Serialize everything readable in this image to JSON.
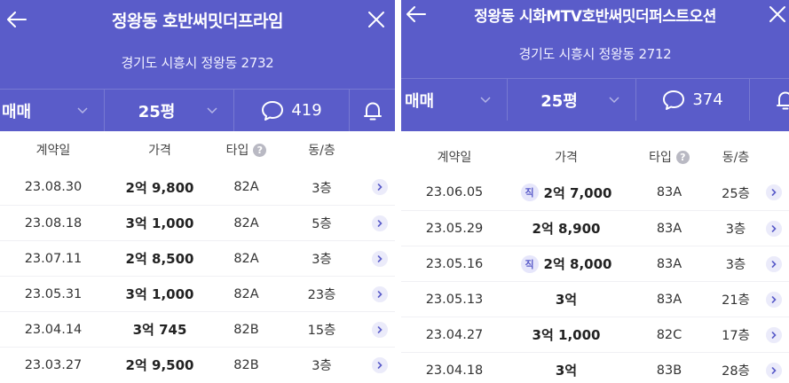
{
  "colors": {
    "header": "#5a5cc9",
    "accent": "#5a5cc9",
    "badge_bg": "#e6e6fb"
  },
  "left": {
    "title": "정왕동 호반써밋더프라임",
    "address": "경기도 시흥시 정왕동 2732",
    "filters": {
      "deal_type": "매매",
      "size": "25평",
      "comments": "419"
    },
    "columns": [
      "계약일",
      "가격",
      "타입",
      "동/층"
    ],
    "help_glyph": "?",
    "rows": [
      {
        "date": "23.08.30",
        "price": "2억 9,800",
        "type": "82A",
        "floor": "3층",
        "direct": ""
      },
      {
        "date": "23.08.18",
        "price": "3억 1,000",
        "type": "82A",
        "floor": "5층",
        "direct": ""
      },
      {
        "date": "23.07.11",
        "price": "2억 8,500",
        "type": "82A",
        "floor": "3층",
        "direct": ""
      },
      {
        "date": "23.05.31",
        "price": "3억 1,000",
        "type": "82A",
        "floor": "23층",
        "direct": ""
      },
      {
        "date": "23.04.14",
        "price": "3억 745",
        "type": "82B",
        "floor": "15층",
        "direct": ""
      },
      {
        "date": "23.03.27",
        "price": "2억 9,500",
        "type": "82B",
        "floor": "3층",
        "direct": ""
      }
    ]
  },
  "right": {
    "title": "정왕동 시화MTV호반써밋더퍼스트오션",
    "address": "경기도 시흥시 정왕동 2712",
    "filters": {
      "deal_type": "매매",
      "size": "25평",
      "comments": "374"
    },
    "columns": [
      "계약일",
      "가격",
      "타입",
      "동/층"
    ],
    "help_glyph": "?",
    "rows": [
      {
        "date": "23.06.05",
        "price": "2억 7,000",
        "type": "83A",
        "floor": "25층",
        "direct": "직"
      },
      {
        "date": "23.05.29",
        "price": "2억 8,900",
        "type": "83A",
        "floor": "3층",
        "direct": ""
      },
      {
        "date": "23.05.16",
        "price": "2억 8,000",
        "type": "83A",
        "floor": "3층",
        "direct": "직"
      },
      {
        "date": "23.05.13",
        "price": "3억",
        "type": "83A",
        "floor": "21층",
        "direct": ""
      },
      {
        "date": "23.04.27",
        "price": "3억 1,000",
        "type": "82C",
        "floor": "17층",
        "direct": ""
      },
      {
        "date": "23.04.18",
        "price": "3억",
        "type": "83B",
        "floor": "28층",
        "direct": ""
      }
    ]
  }
}
